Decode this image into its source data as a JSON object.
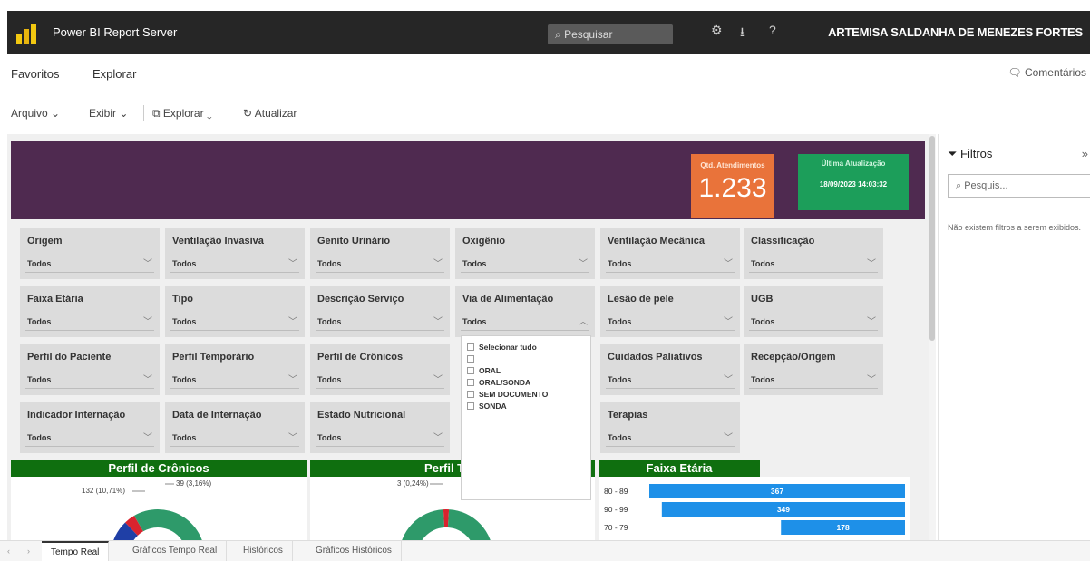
{
  "app": {
    "title": "Power BI Report Server",
    "search_placeholder": "Pesquisar",
    "user": "ARTEMISA SALDANHA DE MENEZES FORTES"
  },
  "nav": {
    "favorites": "Favoritos",
    "explore": "Explorar",
    "comments": "Comentários"
  },
  "toolbar": {
    "file": "Arquivo",
    "view": "Exibir",
    "explore": "Explorar",
    "refresh": "Atualizar"
  },
  "kpi": {
    "label": "Qtd. Atendimentos",
    "value": "1.233"
  },
  "update": {
    "label": "Última Atualização",
    "value": "18/09/2023 14:03:32"
  },
  "slicers": [
    {
      "label": "Origem",
      "value": "Todos"
    },
    {
      "label": "Ventilação Invasiva",
      "value": "Todos"
    },
    {
      "label": "Genito Urinário",
      "value": "Todos"
    },
    {
      "label": "Oxigênio",
      "value": "Todos"
    },
    {
      "label": "Ventilação Mecânica",
      "value": "Todos"
    },
    {
      "label": "Classificação",
      "value": "Todos"
    },
    {
      "label": "Faixa Etária",
      "value": "Todos"
    },
    {
      "label": "Tipo",
      "value": "Todos"
    },
    {
      "label": "Descrição Serviço",
      "value": "Todos"
    },
    {
      "label": "Via de Alimentação",
      "value": "Todos"
    },
    {
      "label": "Lesão de pele",
      "value": "Todos"
    },
    {
      "label": "UGB",
      "value": "Todos"
    },
    {
      "label": "Perfil do Paciente",
      "value": "Todos"
    },
    {
      "label": "Perfil Temporário",
      "value": "Todos"
    },
    {
      "label": "Perfil de Crônicos",
      "value": "Todos"
    },
    {
      "label": "Cuidados Paliativos",
      "value": "Todos"
    },
    {
      "label": "Recepção/Origem",
      "value": "Todos"
    },
    {
      "label": "Indicador Internação",
      "value": "Todos"
    },
    {
      "label": "Data de Internação",
      "value": "Todos"
    },
    {
      "label": "Estado Nutricional",
      "value": "Todos"
    },
    {
      "label": "Terapias",
      "value": "Todos"
    }
  ],
  "dropdown_options": [
    "Selecionar tudo",
    "",
    "ORAL",
    "ORAL/SONDA",
    "SEM DOCUMENTO",
    "SONDA"
  ],
  "sections": {
    "cronicos": "Perfil de Crônicos",
    "temp": "Perfil Tem",
    "faixa": "Faixa Etária"
  },
  "chart_data": [
    {
      "type": "pie",
      "title": "Perfil de Crônicos",
      "labels": [
        "132 (10,71%)",
        "39 (3,16%)"
      ],
      "values": [
        132,
        39
      ],
      "colors": [
        "#1f3fa6",
        "#d9232e",
        "#2e9a6a"
      ]
    },
    {
      "type": "pie",
      "title": "Perfil Tem",
      "labels": [
        "3 (0,24%)"
      ],
      "values": [
        3
      ],
      "colors": [
        "#d9232e",
        "#2e9a6a"
      ]
    },
    {
      "type": "bar",
      "title": "Faixa Etária",
      "categories": [
        "80 - 89",
        "90 - 99",
        "70 - 79"
      ],
      "values": [
        367,
        349,
        178
      ],
      "color": "#1e90e8"
    }
  ],
  "filters_pane": {
    "title": "Filtros",
    "search_placeholder": "Pesquis...",
    "message": "Não existem filtros a serem exibidos."
  },
  "tabs": [
    "Tempo Real",
    "Gráficos Tempo Real",
    "Históricos",
    "Gráficos Históricos"
  ]
}
